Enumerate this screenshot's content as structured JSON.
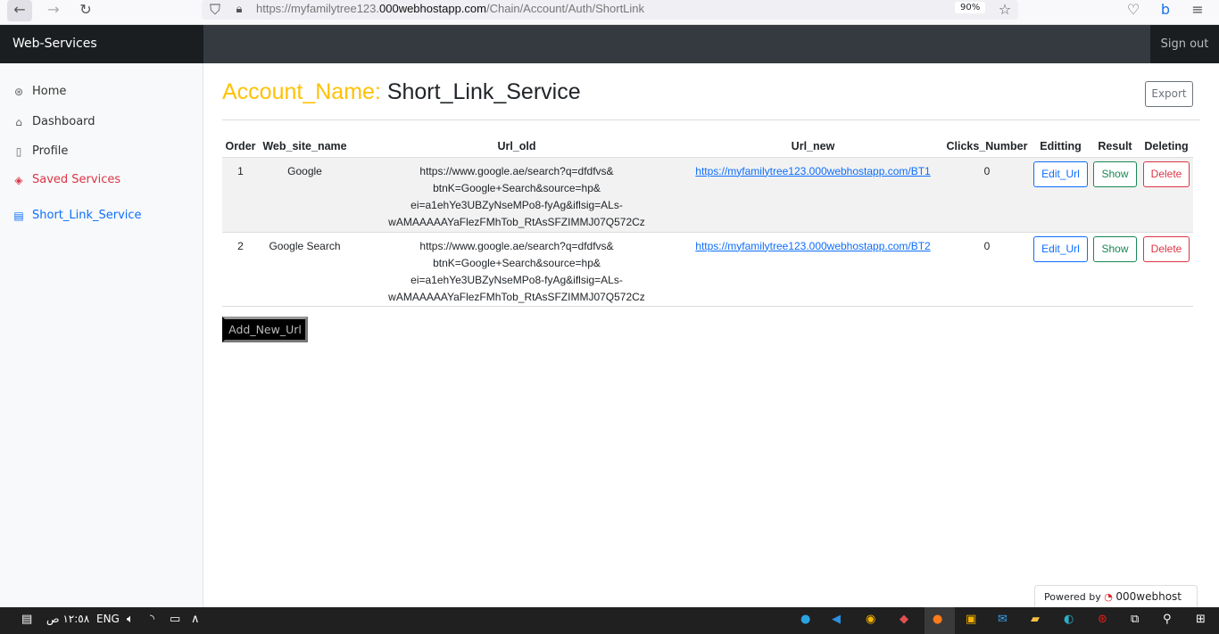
{
  "browser": {
    "url_prefix": "https://myfamilytree123.",
    "url_domain": "000webhostapp.com",
    "url_path": "/Chain/Account/Auth/ShortLink",
    "zoom": "90%"
  },
  "navbar": {
    "brand": "Web-Services",
    "signout": "Sign out"
  },
  "sidebar": {
    "items": [
      {
        "label": "Home",
        "icon": "aperture-icon"
      },
      {
        "label": "Dashboard",
        "icon": "home-icon"
      },
      {
        "label": "Profile",
        "icon": "file-icon"
      },
      {
        "label": "Saved Services",
        "icon": "layers-icon"
      },
      {
        "label": "Short_Link_Service",
        "icon": "file-text-icon"
      }
    ]
  },
  "main": {
    "title_key": "Account_Name:",
    "title_value": "Short_Link_Service",
    "export": "Export",
    "add_button": "Add_New_Url",
    "columns": [
      "Order",
      "Web_site_name",
      "Url_old",
      "Url_new",
      "Clicks_Number",
      "Editting",
      "Result",
      "Deleting"
    ],
    "rows": [
      {
        "order": "1",
        "name": "Google",
        "url_old": "https://www.google.ae/search?q=dfdfvs& btnK=Google+Search&source=hp& ei=a1ehYe3UBZyNseMPo8-fyAg&iflsig=ALs- wAMAAAAAYaFlezFMhTob_RtAsSFZIMMJ07Q572Cz",
        "url_new": "https://myfamilytree123.000webhostapp.com/BT1",
        "clicks": "0",
        "edit": "Edit_Url",
        "show": "Show",
        "delete": "Delete"
      },
      {
        "order": "2",
        "name": "Google Search",
        "url_old": "https://www.google.ae/search?q=dfdfvs& btnK=Google+Search&source=hp& ei=a1ehYe3UBZyNseMPo8-fyAg&iflsig=ALs- wAMAAAAAYaFlezFMhTob_RtAsSFZIMMJ07Q572Cz",
        "url_new": "https://myfamilytree123.000webhostapp.com/BT2",
        "clicks": "0",
        "edit": "Edit_Url",
        "show": "Show",
        "delete": "Delete"
      }
    ]
  },
  "footer": {
    "powered_by": "Powered by",
    "host": "000webhost"
  },
  "taskbar": {
    "time": "١٢:٥٨ ص",
    "lang": "ENG"
  },
  "colors": {
    "accent": "#ffc107",
    "active": "#dc3545",
    "link": "#0d6efd"
  }
}
